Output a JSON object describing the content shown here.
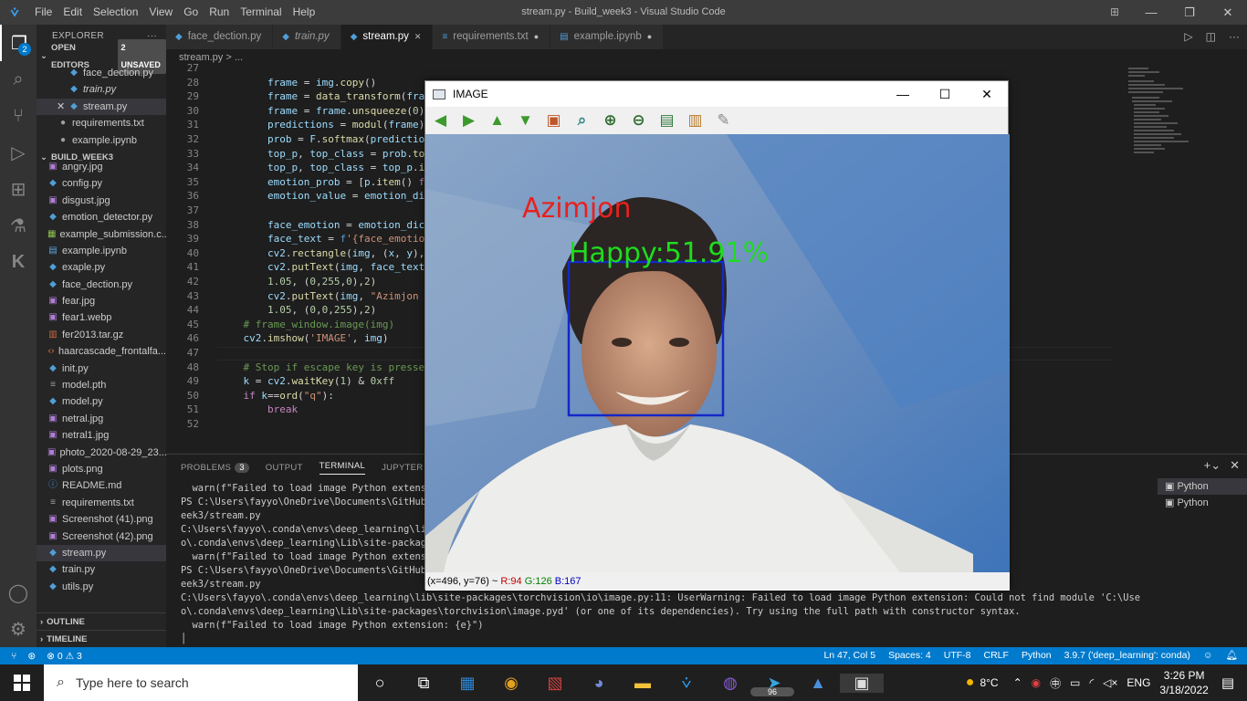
{
  "window": {
    "title": "stream.py - Build_week3 - Visual Studio Code",
    "menus": [
      "File",
      "Edit",
      "Selection",
      "View",
      "Go",
      "Run",
      "Terminal",
      "Help"
    ]
  },
  "activity": {
    "explorer_badge": "2"
  },
  "sidebar": {
    "header": "EXPLORER",
    "open_editors_label": "OPEN EDITORS",
    "unsaved_label": "2 UNSAVED",
    "open_editors": [
      {
        "name": "face_dection.py",
        "icon": "python-icon",
        "italic": false
      },
      {
        "name": "train.py",
        "icon": "python-icon",
        "italic": true
      },
      {
        "name": "stream.py",
        "icon": "python-icon",
        "italic": false,
        "selected": true
      },
      {
        "name": "requirements.txt",
        "icon": "dot",
        "italic": false
      },
      {
        "name": "example.ipynb",
        "icon": "dot",
        "italic": false
      }
    ],
    "folder_label": "BUILD_WEEK3",
    "files": [
      {
        "name": "angry.jpg",
        "icon": "image-icon"
      },
      {
        "name": "config.py",
        "icon": "python-icon"
      },
      {
        "name": "disgust.jpg",
        "icon": "image-icon"
      },
      {
        "name": "emotion_detector.py",
        "icon": "python-icon"
      },
      {
        "name": "example_submission.c...",
        "icon": "csv-icon"
      },
      {
        "name": "example.ipynb",
        "icon": "notebook-icon"
      },
      {
        "name": "exaple.py",
        "icon": "python-icon"
      },
      {
        "name": "face_dection.py",
        "icon": "python-icon"
      },
      {
        "name": "fear.jpg",
        "icon": "image-icon"
      },
      {
        "name": "fear1.webp",
        "icon": "image-icon"
      },
      {
        "name": "fer2013.tar.gz",
        "icon": "archive-icon"
      },
      {
        "name": "haarcascade_frontalfa...",
        "icon": "xml-icon"
      },
      {
        "name": "init.py",
        "icon": "python-icon"
      },
      {
        "name": "model.pth",
        "icon": "text-icon"
      },
      {
        "name": "model.py",
        "icon": "python-icon"
      },
      {
        "name": "netral.jpg",
        "icon": "image-icon"
      },
      {
        "name": "netral1.jpg",
        "icon": "image-icon"
      },
      {
        "name": "photo_2020-08-29_23...",
        "icon": "image-icon"
      },
      {
        "name": "plots.png",
        "icon": "image-icon"
      },
      {
        "name": "README.md",
        "icon": "info-icon"
      },
      {
        "name": "requirements.txt",
        "icon": "text-icon"
      },
      {
        "name": "Screenshot (41).png",
        "icon": "image-icon"
      },
      {
        "name": "Screenshot (42).png",
        "icon": "image-icon"
      },
      {
        "name": "stream.py",
        "icon": "python-icon",
        "selected": true
      },
      {
        "name": "train.py",
        "icon": "python-icon"
      },
      {
        "name": "utils.py",
        "icon": "python-icon"
      }
    ],
    "outline_label": "OUTLINE",
    "timeline_label": "TIMELINE"
  },
  "tabs": [
    {
      "label": "face_dection.py",
      "active": false,
      "italic": false,
      "dirty": false
    },
    {
      "label": "train.py",
      "active": false,
      "italic": true,
      "dirty": false
    },
    {
      "label": "stream.py",
      "active": true,
      "italic": false,
      "dirty": false
    },
    {
      "label": "requirements.txt",
      "active": false,
      "italic": false,
      "dirty": true
    },
    {
      "label": "example.ipynb",
      "active": false,
      "italic": false,
      "dirty": true
    }
  ],
  "breadcrumb": "stream.py > ...",
  "editor": {
    "lines": [
      {
        "n": "27",
        "html": ""
      },
      {
        "n": "28",
        "html": "        <span class='v'>frame</span> = <span class='v'>img</span>.<span class='f'>copy</span>()"
      },
      {
        "n": "29",
        "html": "        <span class='v'>frame</span> = <span class='f'>data_transform</span>(<span class='v'>frame</span>)"
      },
      {
        "n": "30",
        "html": "        <span class='v'>frame</span> = <span class='v'>frame</span>.<span class='f'>unsqueeze</span>(<span class='n'>0</span>)"
      },
      {
        "n": "31",
        "html": "        <span class='v'>predictions</span> = <span class='f'>modul</span>(<span class='v'>frame</span>)"
      },
      {
        "n": "32",
        "html": "        <span class='v'>prob</span> = <span class='v'>F</span>.<span class='f'>softmax</span>(<span class='v'>predictions</span>"
      },
      {
        "n": "33",
        "html": "        <span class='v'>top_p</span>, <span class='v'>top_class</span> = <span class='v'>prob</span>.<span class='f'>topk</span>"
      },
      {
        "n": "34",
        "html": "        <span class='v'>top_p</span>, <span class='v'>top_class</span> = <span class='v'>top_p</span>.<span class='f'>ite</span>"
      },
      {
        "n": "35",
        "html": "        <span class='v'>emotion_prob</span> = [<span class='v'>p</span>.<span class='f'>item</span>() <span class='k'>fo</span>"
      },
      {
        "n": "36",
        "html": "        <span class='v'>emotion_value</span> = <span class='v'>emotion_dict</span>"
      },
      {
        "n": "37",
        "html": ""
      },
      {
        "n": "38",
        "html": "        <span class='v'>face_emotion</span> = <span class='v'>emotion_dict</span>"
      },
      {
        "n": "39",
        "html": "        <span class='v'>face_text</span> = <span class='b'>f</span><span class='s'>'{face_emotion</span>"
      },
      {
        "n": "40",
        "html": "        <span class='v'>cv2</span>.<span class='f'>rectangle</span>(<span class='v'>img</span>, (<span class='v'>x</span>, <span class='v'>y</span>), "
      },
      {
        "n": "41",
        "html": "        <span class='v'>cv2</span>.<span class='f'>putText</span>(<span class='v'>img</span>, <span class='v'>face_text</span>,"
      },
      {
        "n": "42",
        "html": "        <span class='n'>1.05</span>, (<span class='n'>0</span>,<span class='n'>255</span>,<span class='n'>0</span>),<span class='n'>2</span>)"
      },
      {
        "n": "43",
        "html": "        <span class='v'>cv2</span>.<span class='f'>putText</span>(<span class='v'>img</span>, <span class='s'>\"Azimjon \"</span>"
      },
      {
        "n": "44",
        "html": "        <span class='n'>1.05</span>, (<span class='n'>0</span>,<span class='n'>0</span>,<span class='n'>255</span>),<span class='n'>2</span>)"
      },
      {
        "n": "45",
        "html": "    <span class='c'># frame_window.image(img)</span>"
      },
      {
        "n": "46",
        "html": "    <span class='v'>cv2</span>.<span class='f'>imshow</span>(<span class='s'>'IMAGE'</span>, <span class='v'>img</span>)"
      },
      {
        "n": "47",
        "html": ""
      },
      {
        "n": "48",
        "html": "    <span class='c'># Stop if escape key is pressed</span>"
      },
      {
        "n": "49",
        "html": "    <span class='v'>k</span> = <span class='v'>cv2</span>.<span class='f'>waitKey</span>(<span class='n'>1</span>) &amp; <span class='n'>0xff</span>"
      },
      {
        "n": "50",
        "html": "    <span class='k'>if</span> <span class='v'>k</span>==<span class='f'>ord</span>(<span class='s'>\"q\"</span>):"
      },
      {
        "n": "51",
        "html": "        <span class='k'>break</span>"
      },
      {
        "n": "52",
        "html": ""
      }
    ]
  },
  "panel": {
    "tabs": [
      "PROBLEMS",
      "OUTPUT",
      "TERMINAL",
      "JUPYTER",
      "DE"
    ],
    "problems_count": "3",
    "active_tab": "TERMINAL",
    "terminal_lines": [
      "  warn(f\"Failed to load image Python extensio",
      "PS C:\\Users\\fayyo\\OneDrive\\Documents\\GitHub\\B                                                                         Documents/GitHub/Build_w",
      "eek3/stream.py",
      "C:\\Users\\fayyo\\.conda\\envs\\deep_learning\\lib\\                                                                         find module 'C:\\Users\\fayy",
      "o\\.conda\\envs\\deep_learning\\Lib\\site-packages",
      "  warn(f\"Failed to load image Python extensio",
      "PS C:\\Users\\fayyo\\OneDrive\\Documents\\GitHub\\B                                                                         Documents/GitHub/Build_w",
      "eek3/stream.py",
      "C:\\Users\\fayyo\\.conda\\envs\\deep_learning\\lib\\site-packages\\torchvision\\io\\image.py:11: UserWarning: Failed to load image Python extension: Could not find module 'C:\\Users\\fayy",
      "o\\.conda\\envs\\deep_learning\\Lib\\site-packages\\torchvision\\image.pyd' (or one of its dependencies). Try using the full path with constructor syntax.",
      "  warn(f\"Failed to load image Python extension: {e}\")",
      "│"
    ],
    "terminals": [
      "Python",
      "Python"
    ]
  },
  "statusbar": {
    "errors": "0",
    "warnings": "3",
    "position": "Ln 47, Col 5",
    "spaces": "Spaces: 4",
    "encoding": "UTF-8",
    "eol": "CRLF",
    "language": "Python",
    "interpreter": "3.9.7 ('deep_learning': conda)"
  },
  "cv_window": {
    "title": "IMAGE",
    "name_label": "Azimjon",
    "emotion_label": "Happy:51.91%",
    "status_coords": "(x=496, y=76) ~ ",
    "status_r": "R:94",
    "status_g": "G:126",
    "status_b": "B:167"
  },
  "taskbar": {
    "search_placeholder": "Type here to search",
    "temperature": "8°C",
    "language": "ENG",
    "time": "3:26 PM",
    "date": "3/18/2022",
    "notification_count": "96"
  },
  "colors": {
    "accent": "#007acc",
    "name_text": "#e8211f",
    "emotion_text": "#1fdc1f",
    "face_box": "#1428c8"
  }
}
